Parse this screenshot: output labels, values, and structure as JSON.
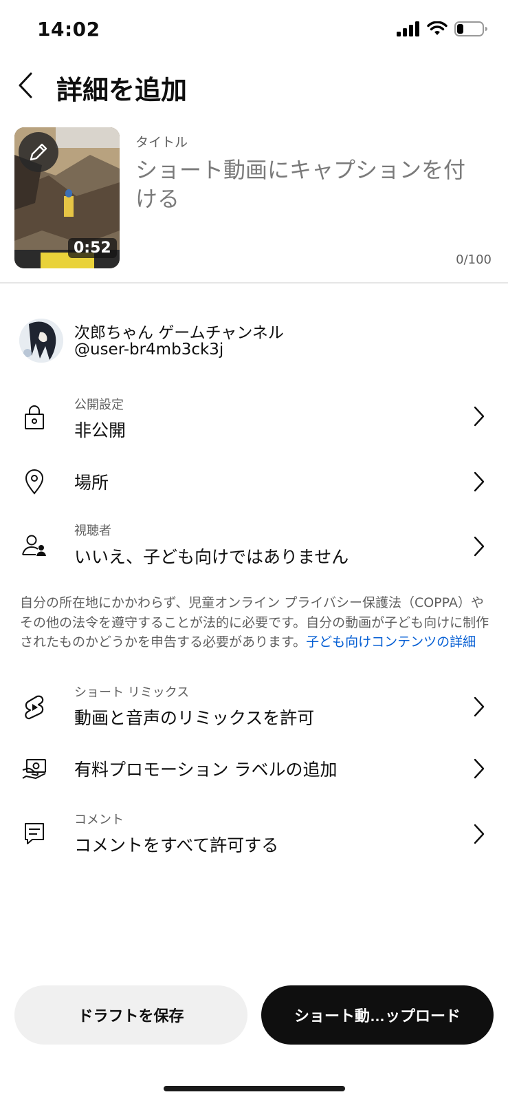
{
  "status_bar": {
    "time": "14:02"
  },
  "header": {
    "title": "詳細を追加"
  },
  "video": {
    "duration": "0:52",
    "title_label": "タイトル",
    "title_placeholder": "ショート動画にキャプションを付ける",
    "char_counter": "0/100"
  },
  "channel": {
    "name": "次郎ちゃん ゲームチャンネル",
    "handle": "@user-br4mb3ck3j"
  },
  "settings": {
    "visibility": {
      "label": "公開設定",
      "value": "非公開"
    },
    "location": {
      "value": "場所"
    },
    "audience": {
      "label": "視聴者",
      "value": "いいえ、子ども向けではありません"
    },
    "remix": {
      "label": "ショート リミックス",
      "value": "動画と音声のリミックスを許可"
    },
    "paid_promotion": {
      "value": "有料プロモーション ラベルの追加"
    },
    "comments": {
      "label": "コメント",
      "value": "コメントをすべて許可する"
    }
  },
  "notice": {
    "text": "自分の所在地にかかわらず、児童オンライン プライバシー保護法（COPPA）やその他の法令を遵守することが法的に必要です。自分の動画が子ども向けに制作されたものかどうかを申告する必要があります。",
    "link": "子ども向けコンテンツの詳細"
  },
  "buttons": {
    "save_draft": "ドラフトを保存",
    "upload": "ショート動…ップロード"
  },
  "colors": {
    "link": "#065fd4",
    "primary_button": "#0f0f0f",
    "secondary_button": "#f0f0f0"
  }
}
